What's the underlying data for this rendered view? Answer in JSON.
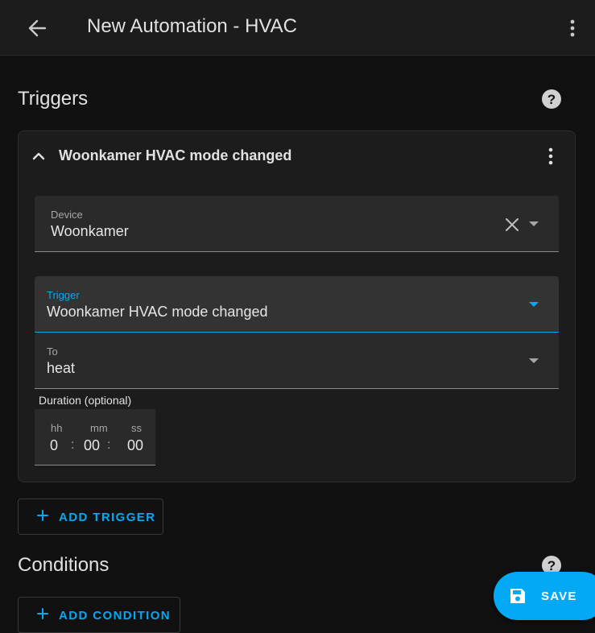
{
  "header": {
    "title": "New Automation - HVAC",
    "back_icon": "arrow-left-icon",
    "menu_icon": "dots-vertical-icon"
  },
  "triggers_section": {
    "title": "Triggers",
    "help_icon": "help-circle-icon"
  },
  "trigger_card": {
    "title": "Woonkamer HVAC mode changed",
    "device": {
      "label": "Device",
      "value": "Woonkamer"
    },
    "trigger": {
      "label": "Trigger",
      "value": "Woonkamer HVAC mode changed"
    },
    "to": {
      "label": "To",
      "value": "heat"
    },
    "duration": {
      "label": "Duration (optional)",
      "hh_label": "hh",
      "hh": "0",
      "mm_label": "mm",
      "mm": "00",
      "ss_label": "ss",
      "ss": "00",
      "separator": ":"
    }
  },
  "add_trigger_label": "ADD TRIGGER",
  "conditions_section": {
    "title": "Conditions",
    "help_icon": "help-circle-icon"
  },
  "add_condition_label": "ADD CONDITION",
  "save_label": "SAVE",
  "colors": {
    "accent": "#03a9f4",
    "background": "#111111",
    "card": "#1c1c1c",
    "field": "#2a2a2a"
  }
}
